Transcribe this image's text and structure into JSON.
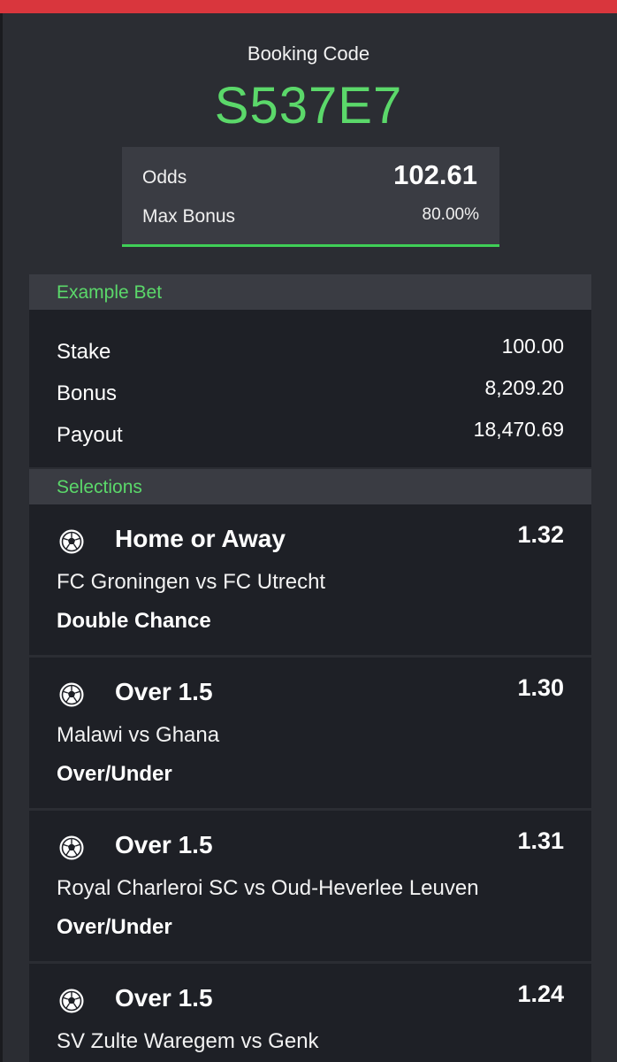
{
  "booking": {
    "label": "Booking Code",
    "code": "S537E7",
    "odds_label": "Odds",
    "odds_value": "102.61",
    "bonus_label": "Max Bonus",
    "bonus_value": "80.00%"
  },
  "example_bet": {
    "title": "Example Bet",
    "rows": [
      {
        "label": "Stake",
        "value": "100.00"
      },
      {
        "label": "Bonus",
        "value": "8,209.20"
      },
      {
        "label": "Payout",
        "value": "18,470.69"
      }
    ]
  },
  "selections": {
    "title": "Selections",
    "items": [
      {
        "pick": "Home or Away",
        "odds": "1.32",
        "match": "FC Groningen vs FC Utrecht",
        "market": "Double Chance",
        "icon": "soccer-ball-icon"
      },
      {
        "pick": "Over 1.5",
        "odds": "1.30",
        "match": "Malawi vs Ghana",
        "market": "Over/Under",
        "icon": "soccer-ball-icon"
      },
      {
        "pick": "Over 1.5",
        "odds": "1.31",
        "match": "Royal Charleroi SC vs Oud-Heverlee Leuven",
        "market": "Over/Under",
        "icon": "soccer-ball-icon"
      },
      {
        "pick": "Over 1.5",
        "odds": "1.24",
        "match": "SV Zulte Waregem vs Genk",
        "market": "",
        "icon": "soccer-ball-icon"
      }
    ]
  },
  "colors": {
    "accent_green": "#5bd86a",
    "top_bar_red": "#d9363d",
    "background": "#2b2d33",
    "panel": "#1e2026"
  }
}
